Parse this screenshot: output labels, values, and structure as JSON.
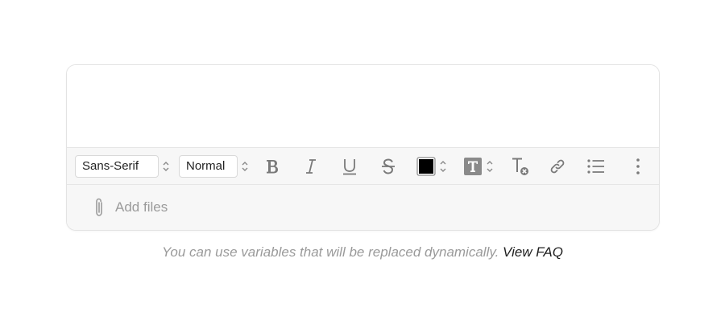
{
  "toolbar": {
    "font_family": "Sans-Serif",
    "font_size": "Normal",
    "text_color": "#000000",
    "background_color_icon_bg": "#8a8a8a",
    "icons": [
      "bold-icon",
      "italic-icon",
      "underline-icon",
      "strikethrough-icon",
      "text-color-icon",
      "background-color-icon",
      "clear-format-icon",
      "link-icon",
      "bulleted-list-icon",
      "more-options-icon"
    ]
  },
  "attachments": {
    "add_label": "Add files",
    "icon": "paperclip-icon"
  },
  "hint": {
    "text": "You can use variables that will be replaced dynamically.",
    "link_label": "View FAQ"
  }
}
